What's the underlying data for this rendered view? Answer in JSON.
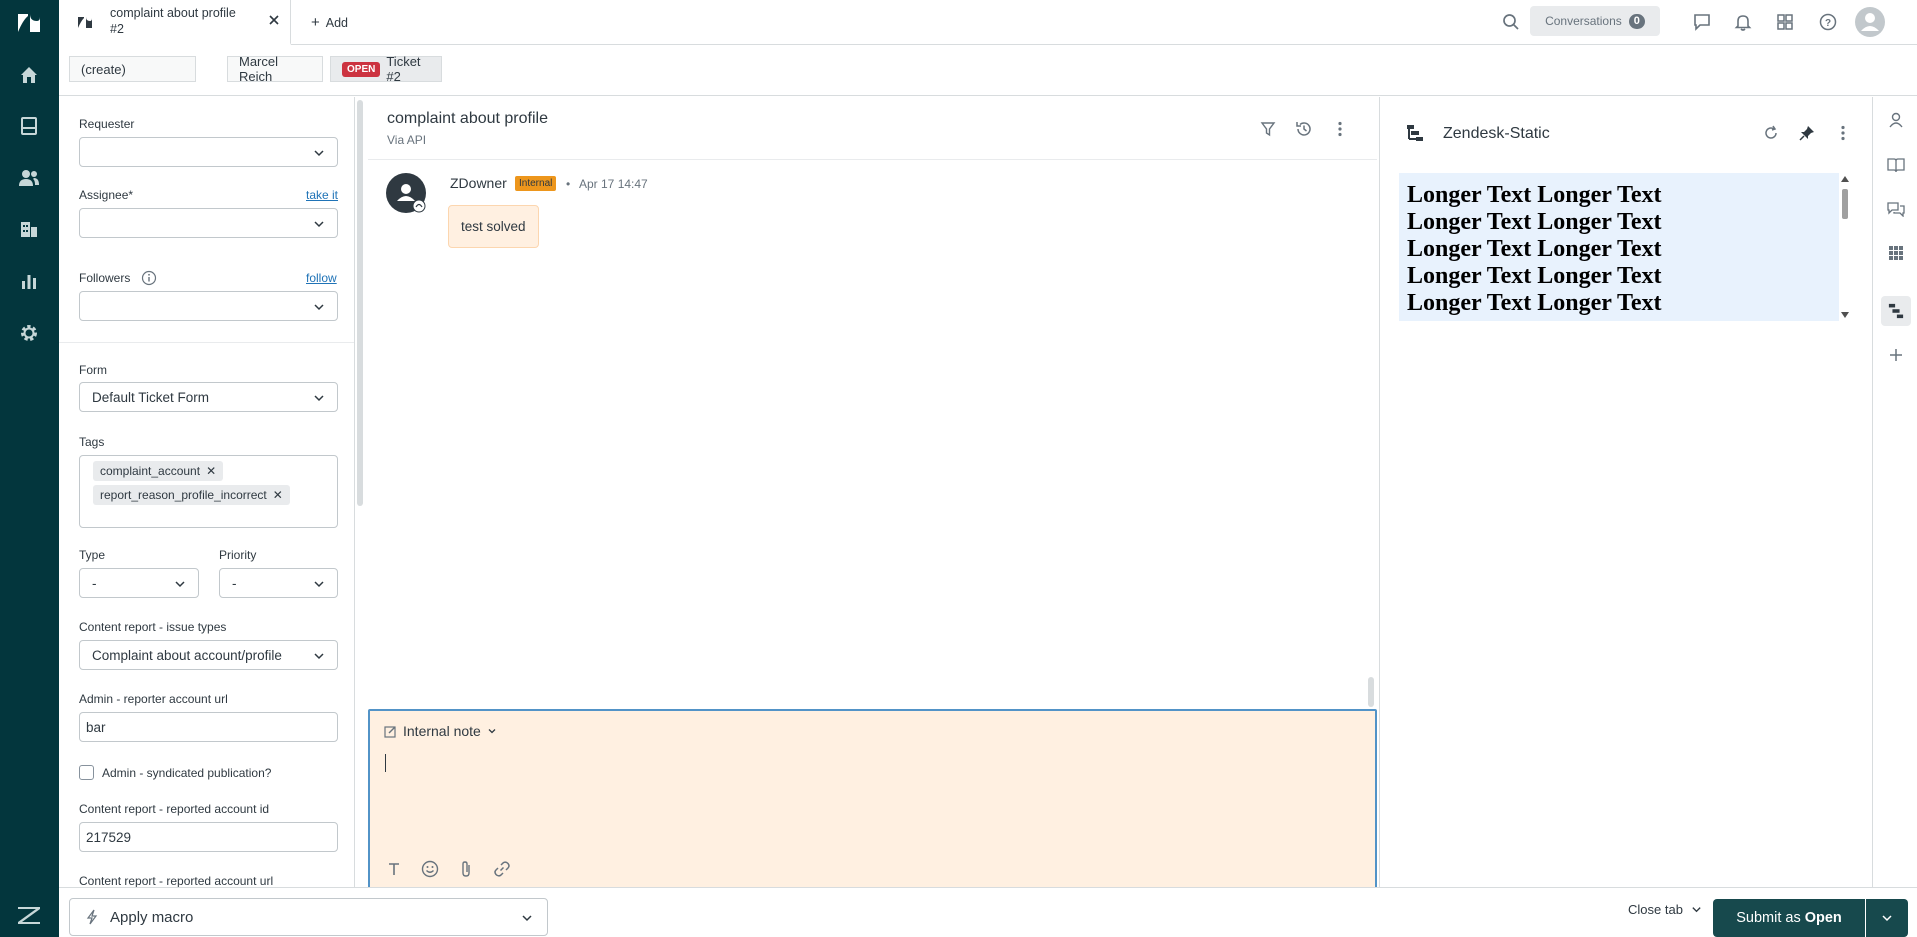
{
  "window": {
    "tab_title": "complaint about profile #2",
    "add_label": "Add"
  },
  "topbar": {
    "conversations_label": "Conversations",
    "conversations_count": "0"
  },
  "breadcrumb": {
    "create": "(create)",
    "user": "Marcel Reich",
    "status_badge": "OPEN",
    "ticket": "Ticket #2"
  },
  "properties": {
    "requester_label": "Requester",
    "requester_value": "",
    "assignee_label": "Assignee*",
    "take_it": "take it",
    "assignee_value": "",
    "followers_label": "Followers",
    "follow": "follow",
    "followers_value": "",
    "form_label": "Form",
    "form_value": "Default Ticket Form",
    "tags_label": "Tags",
    "tags": [
      {
        "text": "complaint_account"
      },
      {
        "text": "report_reason_profile_incorrect"
      }
    ],
    "type_label": "Type",
    "type_value": "-",
    "priority_label": "Priority",
    "priority_value": "-",
    "issue_types_label": "Content report - issue types",
    "issue_types_value": "Complaint about account/profile",
    "reporter_url_label": "Admin - reporter account url",
    "reporter_url_value": "bar",
    "syndicated_label": "Admin - syndicated publication?",
    "syndicated_checked": false,
    "reported_id_label": "Content report - reported account id",
    "reported_id_value": "217529",
    "reported_url_label": "Content report - reported account url"
  },
  "ticket": {
    "title": "complaint about profile",
    "via": "Via API"
  },
  "message": {
    "author": "ZDowner",
    "badge": "Internal",
    "separator": "•",
    "date": "Apr 17 14:47",
    "body": "test solved"
  },
  "composer": {
    "mode": "Internal note"
  },
  "app": {
    "title": "Zendesk-Static",
    "lines": [
      "Longer Text Longer Text",
      "Longer Text Longer Text",
      "Longer Text Longer Text",
      "Longer Text Longer Text",
      "Longer Text Longer Text"
    ]
  },
  "footer": {
    "macro": "Apply macro",
    "close_tab": "Close tab",
    "submit_prefix": "Submit as",
    "submit_status": "Open"
  },
  "colors": {
    "nav_bg": "#03363d",
    "open_badge": "#cc3340",
    "internal_badge": "#ed961c",
    "note_bg": "#fff0e1",
    "submit_bg": "#17494d",
    "link": "#1f73b7"
  },
  "icons": [
    "zendesk-logo-icon",
    "home-icon",
    "views-icon",
    "customers-icon",
    "organizations-icon",
    "reporting-icon",
    "admin-gear-icon",
    "search-icon",
    "chat-icon",
    "bell-icon",
    "apps-grid-icon",
    "help-icon",
    "profile-icon",
    "filter-icon",
    "history-icon",
    "more-icon",
    "refresh-icon",
    "pin-icon",
    "user-icon",
    "knowledge-icon",
    "conversations-icon",
    "apps-icon",
    "app-zendesk-static-icon",
    "plus-icon",
    "bolt-icon",
    "chevron-down-icon",
    "text-format-icon",
    "emoji-icon",
    "attachment-icon",
    "link-icon"
  ]
}
